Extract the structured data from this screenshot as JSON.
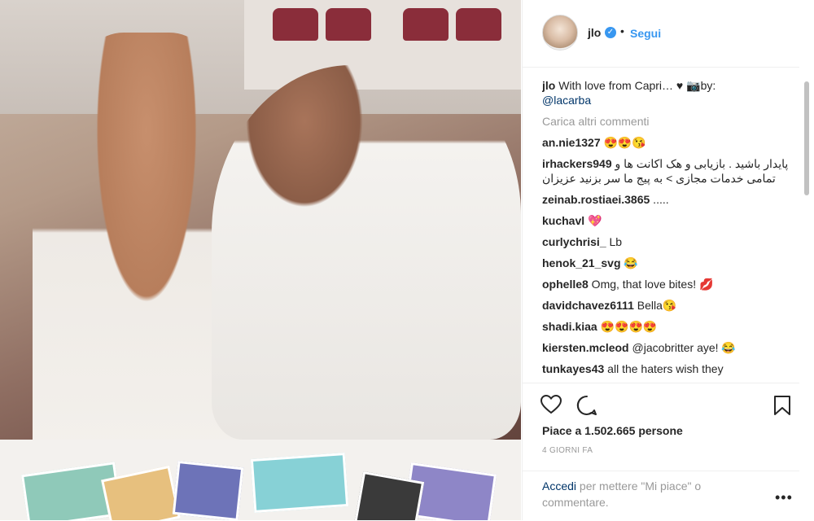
{
  "header": {
    "username": "jlo",
    "dot": "•",
    "follow": "Segui"
  },
  "caption": {
    "user": "jlo",
    "text": " With love from Capri… ♥ 📷by:",
    "mention": "@lacarba"
  },
  "load_more": "Carica altri commenti",
  "comments": [
    {
      "user": "an.nie1327",
      "text": " 😍😍😘"
    },
    {
      "user": "irhackers949",
      "text": " پایدار باشید . بازیابی و هک اکانت ها و تمامی خدمات مجازی > به پیج ما سر بزنید عزیزان",
      "rtl": true
    },
    {
      "user": "zeinab.rostiaei.3865",
      "text": " ....."
    },
    {
      "user": "kuchavl",
      "text": " 💖"
    },
    {
      "user": "curlychrisi_",
      "text": " Lb"
    },
    {
      "user": "henok_21_svg",
      "text": " 😂"
    },
    {
      "user": "ophelle8",
      "text": " Omg, that love bites! 💋"
    },
    {
      "user": "davidchavez6111",
      "text": " Bella😘"
    },
    {
      "user": "shadi.kiaa",
      "text": " 😍😍😍😍"
    },
    {
      "user": "kiersten.mcleod",
      "text": " @jacobritter aye! 😂"
    },
    {
      "user": "tunkayes43",
      "text": " all the haters wish they"
    }
  ],
  "likes": "Piace a 1.502.665 persone",
  "time": "4 GIORNI FA",
  "footer": {
    "login": "Accedi",
    "rest": " per mettere \"Mi piace\" o commentare.",
    "options": "•••"
  },
  "icons": {
    "heart": "heart-icon",
    "comment": "comment-bubble-icon",
    "bookmark": "bookmark-icon",
    "verified": "verified-badge-icon",
    "options": "more-options-icon"
  }
}
